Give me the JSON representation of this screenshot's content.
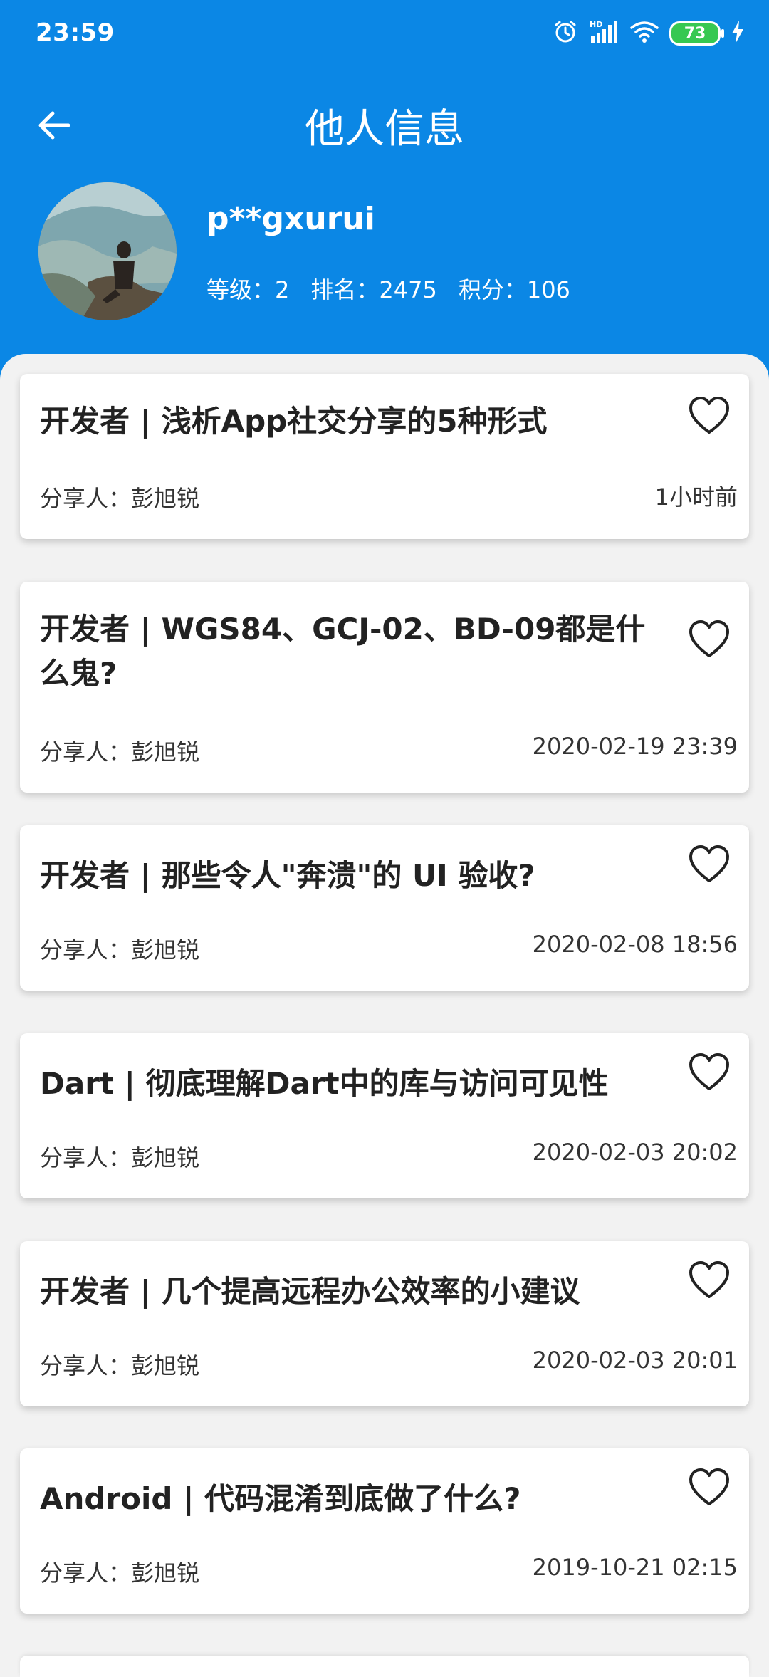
{
  "status_bar": {
    "time": "23:59",
    "battery_level": "73",
    "icons": [
      "alarm-icon",
      "hd-signal-icon",
      "wifi-icon",
      "battery-icon",
      "charging-icon"
    ]
  },
  "nav": {
    "title": "他人信息",
    "back_icon": "arrow-left-icon"
  },
  "profile": {
    "username": "p**gxurui",
    "level_label": "等级：2",
    "rank_label": "排名：2475",
    "points_label": "积分：106"
  },
  "articles": [
    {
      "title": "开发者 | 浅析App社交分享的5种形式",
      "sharer": "分享人：彭旭锐",
      "time": "1小时前"
    },
    {
      "title": "开发者 | WGS84、GCJ-02、BD-09都是什么鬼?",
      "sharer": "分享人：彭旭锐",
      "time": "2020-02-19 23:39"
    },
    {
      "title": "开发者 | 那些令人\"奔溃\"的 UI 验收?",
      "sharer": "分享人：彭旭锐",
      "time": "2020-02-08 18:56"
    },
    {
      "title": "Dart | 彻底理解Dart中的库与访问可见性",
      "sharer": "分享人：彭旭锐",
      "time": "2020-02-03 20:02"
    },
    {
      "title": "开发者 | 几个提高远程办公效率的小建议",
      "sharer": "分享人：彭旭锐",
      "time": "2020-02-03 20:01"
    },
    {
      "title": "Android | 代码混淆到底做了什么?",
      "sharer": "分享人：彭旭锐",
      "time": "2019-10-21 02:15"
    }
  ],
  "colors": {
    "primary": "#0b87e5",
    "background": "#f2f2f2",
    "battery": "#37c852"
  }
}
